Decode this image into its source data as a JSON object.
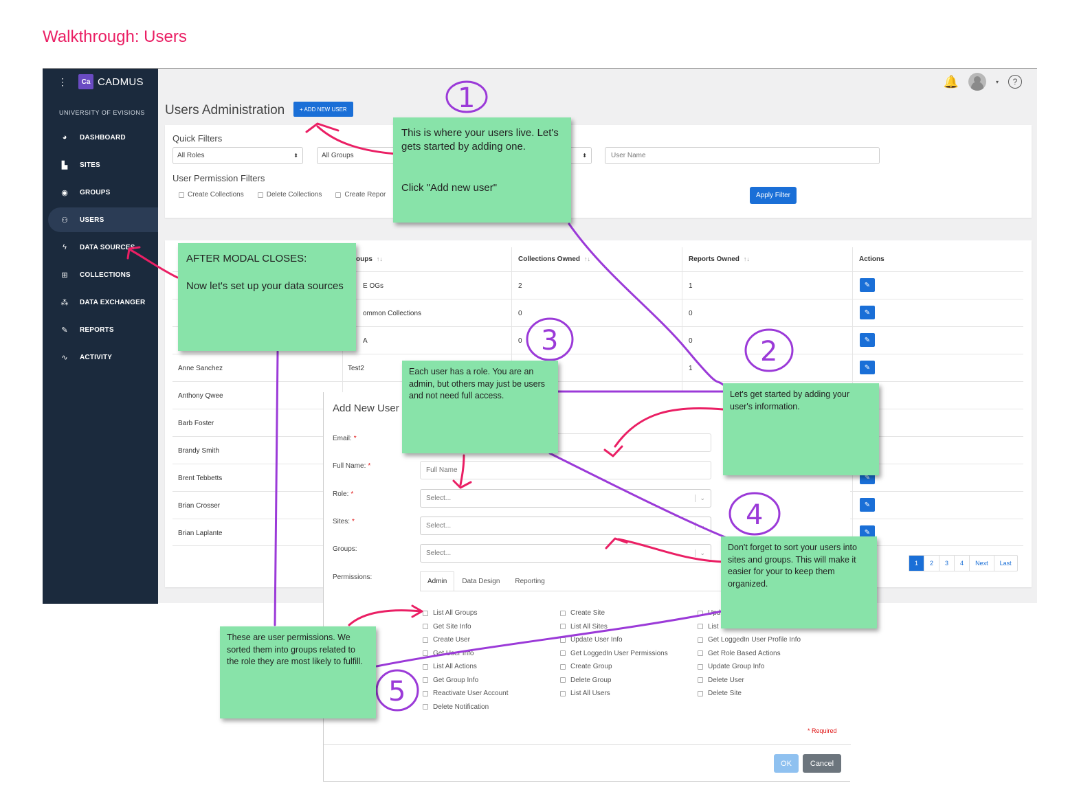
{
  "walkthrough_title": "Walkthrough: Users",
  "app": {
    "brand": {
      "logo": "Ca",
      "name": "CADMUS",
      "menu_icon": "⋮"
    },
    "org_name": "UNIVERSITY OF EVISIONS",
    "nav": [
      {
        "label": "DASHBOARD",
        "icon": "◕"
      },
      {
        "label": "SITES",
        "icon": "▙"
      },
      {
        "label": "GROUPS",
        "icon": "◉"
      },
      {
        "label": "USERS",
        "icon": "⚇"
      },
      {
        "label": "DATA SOURCES",
        "icon": "ϟ"
      },
      {
        "label": "COLLECTIONS",
        "icon": "⊞"
      },
      {
        "label": "DATA EXCHANGER",
        "icon": "⁂"
      },
      {
        "label": "REPORTS",
        "icon": "✎"
      },
      {
        "label": "ACTIVITY",
        "icon": "∿"
      }
    ],
    "topbar": {
      "help_icon": "?",
      "bell_icon": "🔔",
      "caret": "▾"
    },
    "heading": "Users Administration",
    "add_button": "+ ADD NEW USER",
    "filters": {
      "quick_label": "Quick Filters",
      "roles": "All Roles",
      "groups": "All Groups",
      "user_name_placeholder": "User Name",
      "permission_label": "User Permission Filters",
      "permission_checks": [
        "Create Collections",
        "Delete Collections",
        "Create Repor"
      ],
      "apply": "Apply Filter"
    },
    "table": {
      "headers": {
        "groups": "oups",
        "collections": "Collections Owned",
        "reports": "Reports Owned",
        "actions": "Actions"
      },
      "sort_icon": "↑↓",
      "rows": [
        {
          "name": "",
          "group": "E OGs",
          "collections": "2",
          "reports": "1"
        },
        {
          "name": "",
          "group": "ommon Collections",
          "collections": "0",
          "reports": "0"
        },
        {
          "name": "",
          "group": "A",
          "collections": "0",
          "reports": "0"
        },
        {
          "name": "Anne Sanchez",
          "group": "Test2",
          "collections": "",
          "reports": "1"
        },
        {
          "name": "Anthony Qwee",
          "group": "",
          "collections": "",
          "reports": ""
        },
        {
          "name": "Barb Foster",
          "group": "",
          "collections": "",
          "reports": ""
        },
        {
          "name": "Brandy Smith",
          "group": "",
          "collections": "",
          "reports": ""
        },
        {
          "name": "Brent Tebbetts",
          "group": "",
          "collections": "",
          "reports": ""
        },
        {
          "name": "Brian Crosser",
          "group": "",
          "collections": "",
          "reports": ""
        },
        {
          "name": "Brian Laplante",
          "group": "",
          "collections": "",
          "reports": ""
        }
      ],
      "edit_icon": "✎",
      "pager": [
        "1",
        "2",
        "3",
        "4",
        "Next",
        "Last"
      ]
    }
  },
  "modal": {
    "title": "Add New User",
    "fields": {
      "email": "Email:",
      "full_name": "Full Name:",
      "full_name_placeholder": "Full Name",
      "role": "Role:",
      "sites": "Sites:",
      "groups": "Groups:",
      "permissions": "Permissions:",
      "select_placeholder": "Select...",
      "required_mark": "*"
    },
    "tabs": [
      "Admin",
      "Data Design",
      "Reporting"
    ],
    "perm_col1": [
      "List All Groups",
      "Get Site Info",
      "Create User",
      "Get User Info",
      "List All Actions",
      "Get Group Info",
      "Reactivate User Account",
      "Delete Notification"
    ],
    "perm_col2": [
      "Create Site",
      "List All Sites",
      "Update User Info",
      "Get LoggedIn User Permissions",
      "Create Group",
      "Delete Group",
      "List All Users"
    ],
    "perm_col3": [
      "Upd",
      "List",
      "Get LoggedIn User Profile Info",
      "Get Role Based Actions",
      "Update Group Info",
      "Delete User",
      "Delete Site"
    ],
    "required_note": "* Required",
    "ok": "OK",
    "cancel": "Cancel"
  },
  "notes": {
    "n1": "This is where your users live. Let's gets started by adding one.\n\n\nClick \"Add new user\"",
    "after_modal": "AFTER MODAL CLOSES:\n\nNow let's set up your data sources",
    "n3": "Each user has a role. You are an admin, but others may just be users and not need full access.",
    "n2": "Let's get started by adding your user's information.",
    "n4": "Don't forget to sort your users into sites and groups. This will make it easier for your to keep them organized.",
    "n5": "These are user permissions. We sorted them into groups related to the role they are most likely to fulfill."
  },
  "annotation_numbers": [
    "1",
    "2",
    "3",
    "4",
    "5"
  ],
  "colors": {
    "accent_pink": "#ea1f64",
    "annotation_purple": "#9b3ad8",
    "note_green": "#88e3a9",
    "primary_blue": "#1a6fd7",
    "sidebar": "#1b2a3d"
  }
}
